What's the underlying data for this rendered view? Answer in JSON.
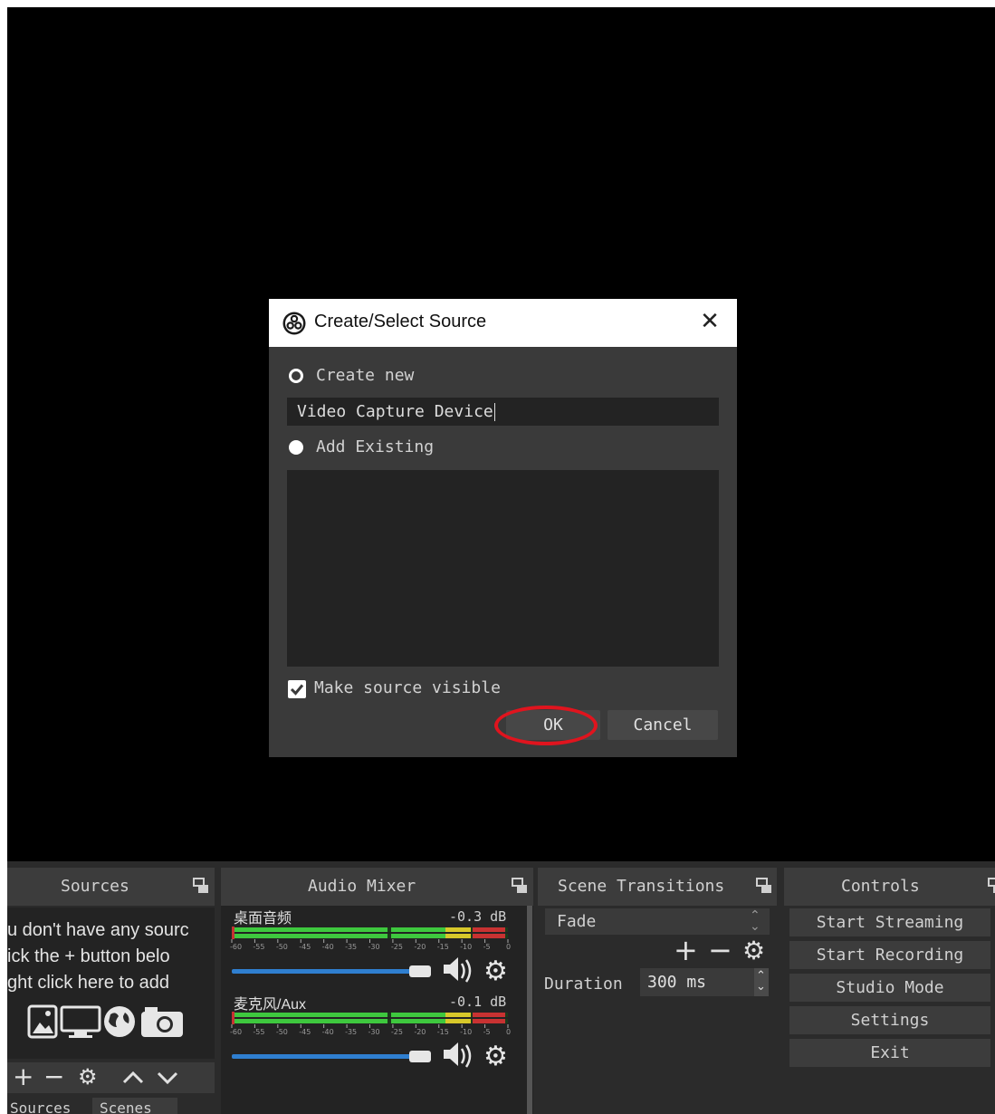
{
  "dialog": {
    "title": "Create/Select Source",
    "create_new_label": "Create new",
    "name_value": "Video Capture Device",
    "add_existing_label": "Add Existing",
    "make_visible_label": "Make source visible",
    "ok_label": "OK",
    "cancel_label": "Cancel"
  },
  "sources": {
    "title": "Sources",
    "empty_line1": "u don't have any sourc",
    "empty_line2": "ick the + button belo",
    "empty_line3": "ght click here to add",
    "tab_sources": "Sources",
    "tab_scenes": "Scenes"
  },
  "mixer": {
    "title": "Audio Mixer",
    "tracks": [
      {
        "name": "桌面音频",
        "db": "-0.3 dB"
      },
      {
        "name": "麦克风/Aux",
        "db": "-0.1 dB"
      }
    ],
    "scale": [
      "-60",
      "-55",
      "-50",
      "-45",
      "-40",
      "-35",
      "-30",
      "-25",
      "-20",
      "-15",
      "-10",
      "-5",
      "0"
    ]
  },
  "transitions": {
    "title": "Scene Transitions",
    "selected": "Fade",
    "duration_label": "Duration",
    "duration_value": "300 ms"
  },
  "controls": {
    "title": "Controls",
    "start_streaming": "Start Streaming",
    "start_recording": "Start Recording",
    "studio_mode": "Studio Mode",
    "settings": "Settings",
    "exit": "Exit"
  },
  "colors": {
    "ok_highlight": "#e0141e",
    "meter_green": "#3ec83e",
    "meter_yellow": "#d8c82a",
    "meter_red": "#c83232",
    "volume_slider": "#2f7fd0"
  }
}
